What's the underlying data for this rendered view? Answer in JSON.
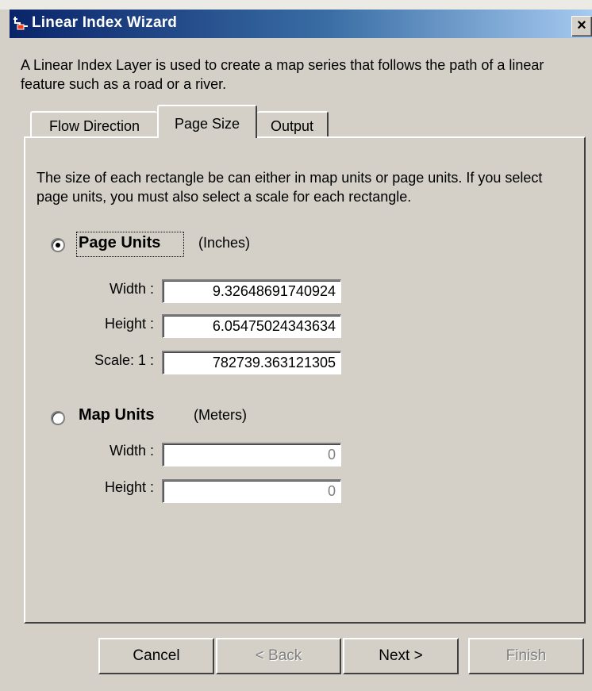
{
  "window": {
    "title": "Linear Index Wizard",
    "close_glyph": "×",
    "icon": "linear-index-icon"
  },
  "intro": "A Linear Index Layer is used to create a map series that follows the path of a linear feature such as a road or a river.",
  "tabs": [
    {
      "label": "Flow Direction",
      "selected": false
    },
    {
      "label": "Page Size",
      "selected": true
    },
    {
      "label": "Output",
      "selected": false
    }
  ],
  "description": "The size of each rectangle be can either in map units or page units.  If you select page units, you must also select a scale for each rectangle.",
  "page_units": {
    "label": "Page Units",
    "unit": "(Inches)",
    "selected": true,
    "width_label": "Width :",
    "width_value": "9.32648691740924",
    "height_label": "Height :",
    "height_value": "6.05475024343634",
    "scale_label": "Scale:  1 :",
    "scale_value": "782739.363121305"
  },
  "map_units": {
    "label": "Map Units",
    "unit": "(Meters)",
    "selected": false,
    "width_label": "Width :",
    "width_value": "0",
    "height_label": "Height :",
    "height_value": "0"
  },
  "buttons": {
    "cancel": "Cancel",
    "back": "< Back",
    "next": "Next >",
    "finish": "Finish"
  },
  "colors": {
    "title_gradient_start": "#0a246a",
    "title_gradient_end": "#a6caf0",
    "face": "#d4d0c8"
  }
}
